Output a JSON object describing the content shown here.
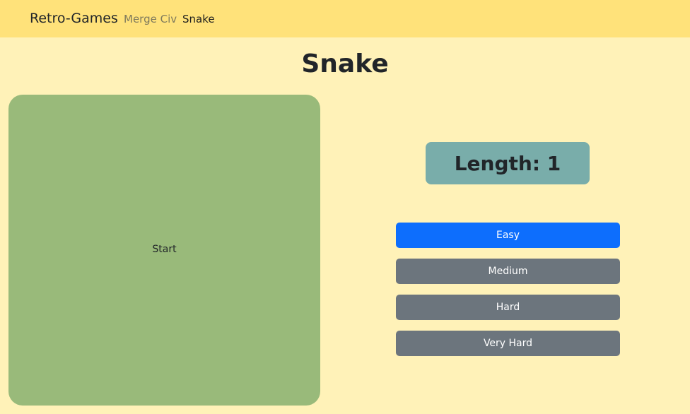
{
  "navbar": {
    "brand": "Retro-Games",
    "links": [
      {
        "label": "Merge Civ"
      },
      {
        "label": "Snake"
      }
    ]
  },
  "page": {
    "title": "Snake"
  },
  "board": {
    "start_label": "Start"
  },
  "score": {
    "length_label": "Length:",
    "length_value": "1",
    "display": "Length: 1"
  },
  "difficulty": {
    "selected": "Easy",
    "options": [
      {
        "label": "Easy"
      },
      {
        "label": "Medium"
      },
      {
        "label": "Hard"
      },
      {
        "label": "Very Hard"
      }
    ]
  },
  "colors": {
    "background": "#fff2b8",
    "navbar": "#ffe27a",
    "board": "#99ba7a",
    "length_box": "#79adaa",
    "selected_button": "#0d6efd",
    "unselected_button": "#6c757d"
  }
}
